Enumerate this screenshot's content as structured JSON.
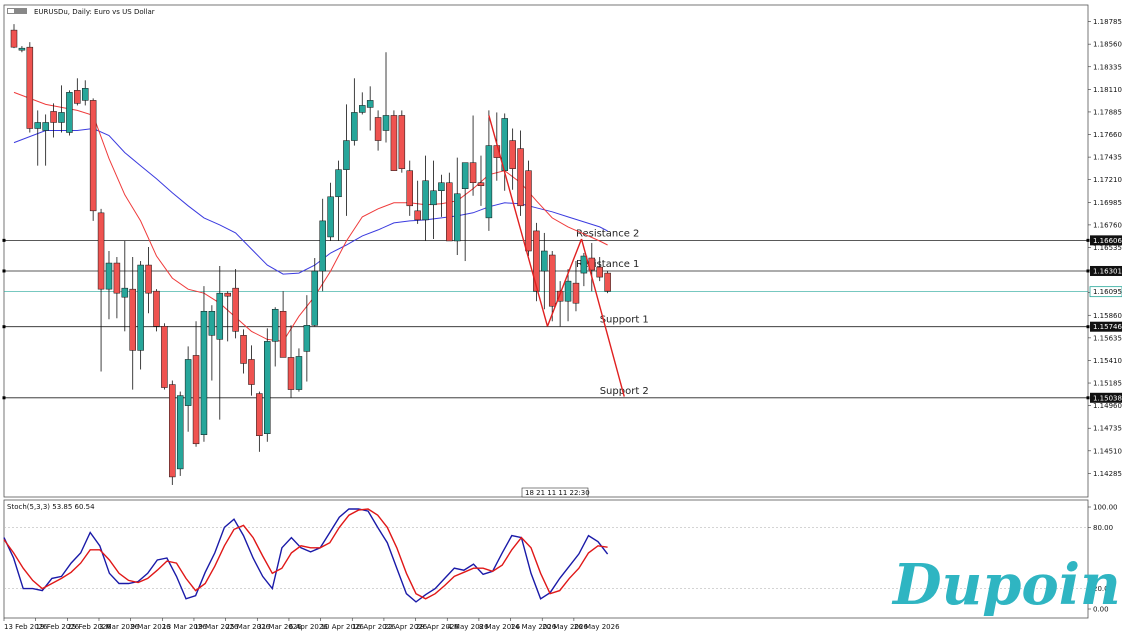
{
  "header": {
    "symbol_title": "EURUSDu, Daily:  Euro vs US Dollar"
  },
  "stoch": {
    "label": "Stoch(5,3,3) 53.85 60.54",
    "levels": [
      {
        "value": 100,
        "label": "100.00"
      },
      {
        "value": 80,
        "label": "80.00"
      },
      {
        "value": 20,
        "label": "20.00"
      },
      {
        "value": 0,
        "label": "0.00"
      }
    ],
    "k_values": [
      70,
      50,
      20,
      20,
      18,
      30,
      32,
      45,
      55,
      75,
      62,
      35,
      25,
      25,
      27,
      35,
      48,
      50,
      32,
      10,
      13,
      36,
      55,
      80,
      88,
      72,
      50,
      32,
      20,
      60,
      70,
      60,
      56,
      60,
      75,
      90,
      98,
      98,
      96,
      80,
      65,
      40,
      15,
      7,
      14,
      20,
      30,
      40,
      38,
      44,
      34,
      37,
      55,
      72,
      70,
      35,
      10,
      16,
      30,
      42,
      54,
      72,
      66,
      53.85
    ],
    "d_values": [
      68,
      55,
      40,
      28,
      20,
      25,
      30,
      36,
      45,
      58,
      58,
      48,
      35,
      28,
      26,
      30,
      38,
      47,
      45,
      30,
      18,
      25,
      42,
      62,
      78,
      82,
      70,
      52,
      35,
      40,
      55,
      62,
      60,
      60,
      65,
      80,
      92,
      97,
      98,
      92,
      80,
      60,
      35,
      15,
      10,
      15,
      23,
      32,
      36,
      40,
      40,
      37,
      43,
      58,
      70,
      60,
      35,
      15,
      18,
      30,
      40,
      55,
      62,
      60.54
    ]
  },
  "branding": {
    "logo_text": "Dupoin",
    "logo_color": "#2fb5c2"
  },
  "colors": {
    "bull": "#26a69a",
    "bear": "#ef5350",
    "ma_fast": "#ef3b3b",
    "ma_slow": "#3b3bdf",
    "current_price_line": "#26a69a",
    "trend_lines": "#e02020",
    "stoch_k": "#1a1aa8",
    "stoch_d": "#e01818"
  },
  "chart_data": {
    "type": "candlestick",
    "ylim": [
      1.1405,
      1.1895
    ],
    "price_ticks": [
      "1.18785",
      "1.18560",
      "1.18335",
      "1.18110",
      "1.17885",
      "1.17660",
      "1.17435",
      "1.17210",
      "1.16985",
      "1.16760",
      "1.16535",
      "1.16310",
      "1.16085",
      "1.15860",
      "1.15635",
      "1.15410",
      "1.15185",
      "1.14960",
      "1.14735",
      "1.14510",
      "1.14285"
    ],
    "date_labels": [
      {
        "index": 0,
        "label": "13 Feb 2026"
      },
      {
        "index": 4,
        "label": "19 Feb 2026"
      },
      {
        "index": 8,
        "label": "25 Feb 2026"
      },
      {
        "index": 12,
        "label": "3 Mar 2026"
      },
      {
        "index": 16,
        "label": "9 Mar 2026"
      },
      {
        "index": 20,
        "label": "13 Mar 2026"
      },
      {
        "index": 24,
        "label": "19 Mar 2026"
      },
      {
        "index": 28,
        "label": "25 Mar 2026"
      },
      {
        "index": 32,
        "label": "31 Mar 2026"
      },
      {
        "index": 36,
        "label": "6 Apr 2026"
      },
      {
        "index": 40,
        "label": "10 Apr 2026"
      },
      {
        "index": 44,
        "label": "16 Apr 2026"
      },
      {
        "index": 48,
        "label": "22 Apr 2026"
      },
      {
        "index": 52,
        "label": "28 Apr 2026"
      },
      {
        "index": 56,
        "label": "4 May 2026"
      },
      {
        "index": 60,
        "label": "8 May 2026"
      },
      {
        "index": 64,
        "label": "14 May 2026"
      },
      {
        "index": 68,
        "label": "20 May 2026"
      },
      {
        "index": 72,
        "label": "26 May 2026"
      }
    ],
    "candles": [
      {
        "o": 1.187,
        "h": 1.1876,
        "l": 1.1852,
        "c": 1.1853
      },
      {
        "o": 1.185,
        "h": 1.1854,
        "l": 1.1848,
        "c": 1.1852
      },
      {
        "o": 1.1853,
        "h": 1.1858,
        "l": 1.1768,
        "c": 1.1772
      },
      {
        "o": 1.1772,
        "h": 1.179,
        "l": 1.1735,
        "c": 1.1778
      },
      {
        "o": 1.177,
        "h": 1.1786,
        "l": 1.1735,
        "c": 1.1778
      },
      {
        "o": 1.1789,
        "h": 1.1797,
        "l": 1.1763,
        "c": 1.1778
      },
      {
        "o": 1.1778,
        "h": 1.1815,
        "l": 1.1768,
        "c": 1.1788
      },
      {
        "o": 1.1768,
        "h": 1.181,
        "l": 1.1765,
        "c": 1.1808
      },
      {
        "o": 1.181,
        "h": 1.1822,
        "l": 1.1795,
        "c": 1.1797
      },
      {
        "o": 1.18,
        "h": 1.182,
        "l": 1.1795,
        "c": 1.1812
      },
      {
        "o": 1.18,
        "h": 1.1802,
        "l": 1.168,
        "c": 1.169
      },
      {
        "o": 1.1688,
        "h": 1.1692,
        "l": 1.153,
        "c": 1.1612
      },
      {
        "o": 1.1612,
        "h": 1.165,
        "l": 1.1582,
        "c": 1.1638
      },
      {
        "o": 1.1638,
        "h": 1.1644,
        "l": 1.1583,
        "c": 1.1608
      },
      {
        "o": 1.1604,
        "h": 1.166,
        "l": 1.157,
        "c": 1.1613
      },
      {
        "o": 1.1612,
        "h": 1.1644,
        "l": 1.1512,
        "c": 1.1551
      },
      {
        "o": 1.1551,
        "h": 1.164,
        "l": 1.1532,
        "c": 1.1636
      },
      {
        "o": 1.1636,
        "h": 1.1654,
        "l": 1.1588,
        "c": 1.1608
      },
      {
        "o": 1.161,
        "h": 1.1612,
        "l": 1.157,
        "c": 1.1575
      },
      {
        "o": 1.1575,
        "h": 1.1578,
        "l": 1.1512,
        "c": 1.1514
      },
      {
        "o": 1.1517,
        "h": 1.1521,
        "l": 1.1417,
        "c": 1.1425
      },
      {
        "o": 1.1433,
        "h": 1.151,
        "l": 1.1426,
        "c": 1.1506
      },
      {
        "o": 1.1496,
        "h": 1.1555,
        "l": 1.147,
        "c": 1.1542
      },
      {
        "o": 1.1546,
        "h": 1.158,
        "l": 1.1455,
        "c": 1.1458
      },
      {
        "o": 1.1467,
        "h": 1.1615,
        "l": 1.146,
        "c": 1.159
      },
      {
        "o": 1.1566,
        "h": 1.1596,
        "l": 1.1521,
        "c": 1.159
      },
      {
        "o": 1.1562,
        "h": 1.1635,
        "l": 1.1482,
        "c": 1.1608
      },
      {
        "o": 1.1608,
        "h": 1.161,
        "l": 1.156,
        "c": 1.1605
      },
      {
        "o": 1.1613,
        "h": 1.1632,
        "l": 1.1563,
        "c": 1.157
      },
      {
        "o": 1.1566,
        "h": 1.1572,
        "l": 1.1528,
        "c": 1.1538
      },
      {
        "o": 1.1542,
        "h": 1.1556,
        "l": 1.1506,
        "c": 1.1517
      },
      {
        "o": 1.1508,
        "h": 1.151,
        "l": 1.145,
        "c": 1.1466
      },
      {
        "o": 1.1468,
        "h": 1.1573,
        "l": 1.146,
        "c": 1.156
      },
      {
        "o": 1.156,
        "h": 1.1594,
        "l": 1.1535,
        "c": 1.1592
      },
      {
        "o": 1.159,
        "h": 1.161,
        "l": 1.1545,
        "c": 1.1544
      },
      {
        "o": 1.1544,
        "h": 1.1576,
        "l": 1.1504,
        "c": 1.1512
      },
      {
        "o": 1.1512,
        "h": 1.1553,
        "l": 1.151,
        "c": 1.1545
      },
      {
        "o": 1.155,
        "h": 1.1606,
        "l": 1.152,
        "c": 1.1576
      },
      {
        "o": 1.1576,
        "h": 1.1643,
        "l": 1.1575,
        "c": 1.163
      },
      {
        "o": 1.163,
        "h": 1.1702,
        "l": 1.161,
        "c": 1.168
      },
      {
        "o": 1.1664,
        "h": 1.1718,
        "l": 1.166,
        "c": 1.1704
      },
      {
        "o": 1.1704,
        "h": 1.174,
        "l": 1.166,
        "c": 1.1731
      },
      {
        "o": 1.1731,
        "h": 1.1796,
        "l": 1.1685,
        "c": 1.176
      },
      {
        "o": 1.176,
        "h": 1.1822,
        "l": 1.1755,
        "c": 1.1788
      },
      {
        "o": 1.1788,
        "h": 1.1808,
        "l": 1.1786,
        "c": 1.1795
      },
      {
        "o": 1.1793,
        "h": 1.1814,
        "l": 1.177,
        "c": 1.18
      },
      {
        "o": 1.1783,
        "h": 1.179,
        "l": 1.175,
        "c": 1.176
      },
      {
        "o": 1.177,
        "h": 1.1848,
        "l": 1.1758,
        "c": 1.1785
      },
      {
        "o": 1.1785,
        "h": 1.179,
        "l": 1.173,
        "c": 1.173
      },
      {
        "o": 1.1785,
        "h": 1.179,
        "l": 1.1728,
        "c": 1.1732
      },
      {
        "o": 1.173,
        "h": 1.174,
        "l": 1.1685,
        "c": 1.1695
      },
      {
        "o": 1.169,
        "h": 1.172,
        "l": 1.1677,
        "c": 1.1681
      },
      {
        "o": 1.1681,
        "h": 1.1745,
        "l": 1.166,
        "c": 1.172
      },
      {
        "o": 1.1696,
        "h": 1.174,
        "l": 1.1662,
        "c": 1.171
      },
      {
        "o": 1.171,
        "h": 1.1726,
        "l": 1.1684,
        "c": 1.1718
      },
      {
        "o": 1.1718,
        "h": 1.1728,
        "l": 1.166,
        "c": 1.166
      },
      {
        "o": 1.166,
        "h": 1.1743,
        "l": 1.1646,
        "c": 1.1707
      },
      {
        "o": 1.1712,
        "h": 1.1735,
        "l": 1.164,
        "c": 1.1738
      },
      {
        "o": 1.1738,
        "h": 1.1785,
        "l": 1.1705,
        "c": 1.1718
      },
      {
        "o": 1.1718,
        "h": 1.1745,
        "l": 1.1695,
        "c": 1.1715
      },
      {
        "o": 1.1683,
        "h": 1.179,
        "l": 1.167,
        "c": 1.1755
      },
      {
        "o": 1.1755,
        "h": 1.1788,
        "l": 1.172,
        "c": 1.1743
      },
      {
        "o": 1.173,
        "h": 1.1787,
        "l": 1.171,
        "c": 1.1782
      },
      {
        "o": 1.176,
        "h": 1.1772,
        "l": 1.1711,
        "c": 1.1732
      },
      {
        "o": 1.1752,
        "h": 1.177,
        "l": 1.1685,
        "c": 1.1695
      },
      {
        "o": 1.173,
        "h": 1.174,
        "l": 1.1645,
        "c": 1.165
      },
      {
        "o": 1.167,
        "h": 1.1678,
        "l": 1.16,
        "c": 1.161
      },
      {
        "o": 1.163,
        "h": 1.1668,
        "l": 1.1592,
        "c": 1.165
      },
      {
        "o": 1.1646,
        "h": 1.165,
        "l": 1.158,
        "c": 1.1595
      },
      {
        "o": 1.161,
        "h": 1.162,
        "l": 1.1575,
        "c": 1.16
      },
      {
        "o": 1.16,
        "h": 1.1632,
        "l": 1.158,
        "c": 1.162
      },
      {
        "o": 1.1618,
        "h": 1.164,
        "l": 1.159,
        "c": 1.1598
      },
      {
        "o": 1.1628,
        "h": 1.1648,
        "l": 1.1615,
        "c": 1.1645
      },
      {
        "o": 1.1643,
        "h": 1.1658,
        "l": 1.161,
        "c": 1.1631
      },
      {
        "o": 1.1634,
        "h": 1.1644,
        "l": 1.162,
        "c": 1.1624
      },
      {
        "o": 1.1628,
        "h": 1.163,
        "l": 1.1608,
        "c": 1.161
      }
    ],
    "ma_fast": [
      [
        0,
        1.1808
      ],
      [
        4,
        1.1796
      ],
      [
        8,
        1.179
      ],
      [
        10,
        1.1785
      ],
      [
        12,
        1.1742
      ],
      [
        14,
        1.1706
      ],
      [
        16,
        1.168
      ],
      [
        18,
        1.1645
      ],
      [
        20,
        1.1623
      ],
      [
        22,
        1.1612
      ],
      [
        24,
        1.1608
      ],
      [
        26,
        1.1598
      ],
      [
        28,
        1.1584
      ],
      [
        30,
        1.157
      ],
      [
        32,
        1.1562
      ],
      [
        34,
        1.156
      ],
      [
        36,
        1.1585
      ],
      [
        38,
        1.1605
      ],
      [
        40,
        1.163
      ],
      [
        42,
        1.166
      ],
      [
        44,
        1.1684
      ],
      [
        46,
        1.1692
      ],
      [
        48,
        1.1698
      ],
      [
        50,
        1.1698
      ],
      [
        52,
        1.1696
      ],
      [
        54,
        1.1697
      ],
      [
        56,
        1.17
      ],
      [
        58,
        1.1712
      ],
      [
        60,
        1.1726
      ],
      [
        62,
        1.173
      ],
      [
        64,
        1.1718
      ],
      [
        66,
        1.17
      ],
      [
        68,
        1.1683
      ],
      [
        70,
        1.1674
      ],
      [
        72,
        1.1667
      ],
      [
        74,
        1.166
      ],
      [
        75,
        1.1656
      ]
    ],
    "ma_slow": [
      [
        0,
        1.1758
      ],
      [
        4,
        1.177
      ],
      [
        8,
        1.177
      ],
      [
        10,
        1.1772
      ],
      [
        12,
        1.1765
      ],
      [
        14,
        1.1748
      ],
      [
        16,
        1.1735
      ],
      [
        18,
        1.1722
      ],
      [
        20,
        1.1708
      ],
      [
        22,
        1.1695
      ],
      [
        24,
        1.1683
      ],
      [
        26,
        1.1676
      ],
      [
        28,
        1.1668
      ],
      [
        30,
        1.1652
      ],
      [
        32,
        1.1636
      ],
      [
        34,
        1.1627
      ],
      [
        36,
        1.1628
      ],
      [
        38,
        1.1636
      ],
      [
        40,
        1.1648
      ],
      [
        42,
        1.1656
      ],
      [
        44,
        1.1665
      ],
      [
        46,
        1.1671
      ],
      [
        48,
        1.1678
      ],
      [
        50,
        1.168
      ],
      [
        52,
        1.1681
      ],
      [
        54,
        1.1683
      ],
      [
        56,
        1.1685
      ],
      [
        58,
        1.1688
      ],
      [
        60,
        1.1694
      ],
      [
        62,
        1.1698
      ],
      [
        64,
        1.1697
      ],
      [
        66,
        1.1693
      ],
      [
        68,
        1.1689
      ],
      [
        70,
        1.1684
      ],
      [
        72,
        1.1679
      ],
      [
        74,
        1.1674
      ],
      [
        75,
        1.167
      ]
    ],
    "current_price": {
      "value": 1.16095,
      "label": "1.16095"
    },
    "levels": [
      {
        "value": 1.16606,
        "axis_label": "1.16606",
        "text": "Resistance 2",
        "text_at_index": 71
      },
      {
        "value": 1.16301,
        "axis_label": "1.16301",
        "text": "Resistance 1",
        "text_at_index": 71
      },
      {
        "value": 1.15746,
        "axis_label": "1.15746",
        "text": "Support 1",
        "text_at_index": 74
      },
      {
        "value": 1.15038,
        "axis_label": "1.15038",
        "text": "Support 2",
        "text_at_index": 74
      }
    ],
    "trend_lines": [
      [
        [
          60,
          1.1785
        ],
        [
          67.4,
          1.1575
        ]
      ],
      [
        [
          67.4,
          1.1575
        ],
        [
          71.7,
          1.1662
        ]
      ],
      [
        [
          71.7,
          1.1662
        ],
        [
          77.1,
          1.1505
        ]
      ]
    ],
    "time_box_label": "18 21 11 11 22:30"
  }
}
